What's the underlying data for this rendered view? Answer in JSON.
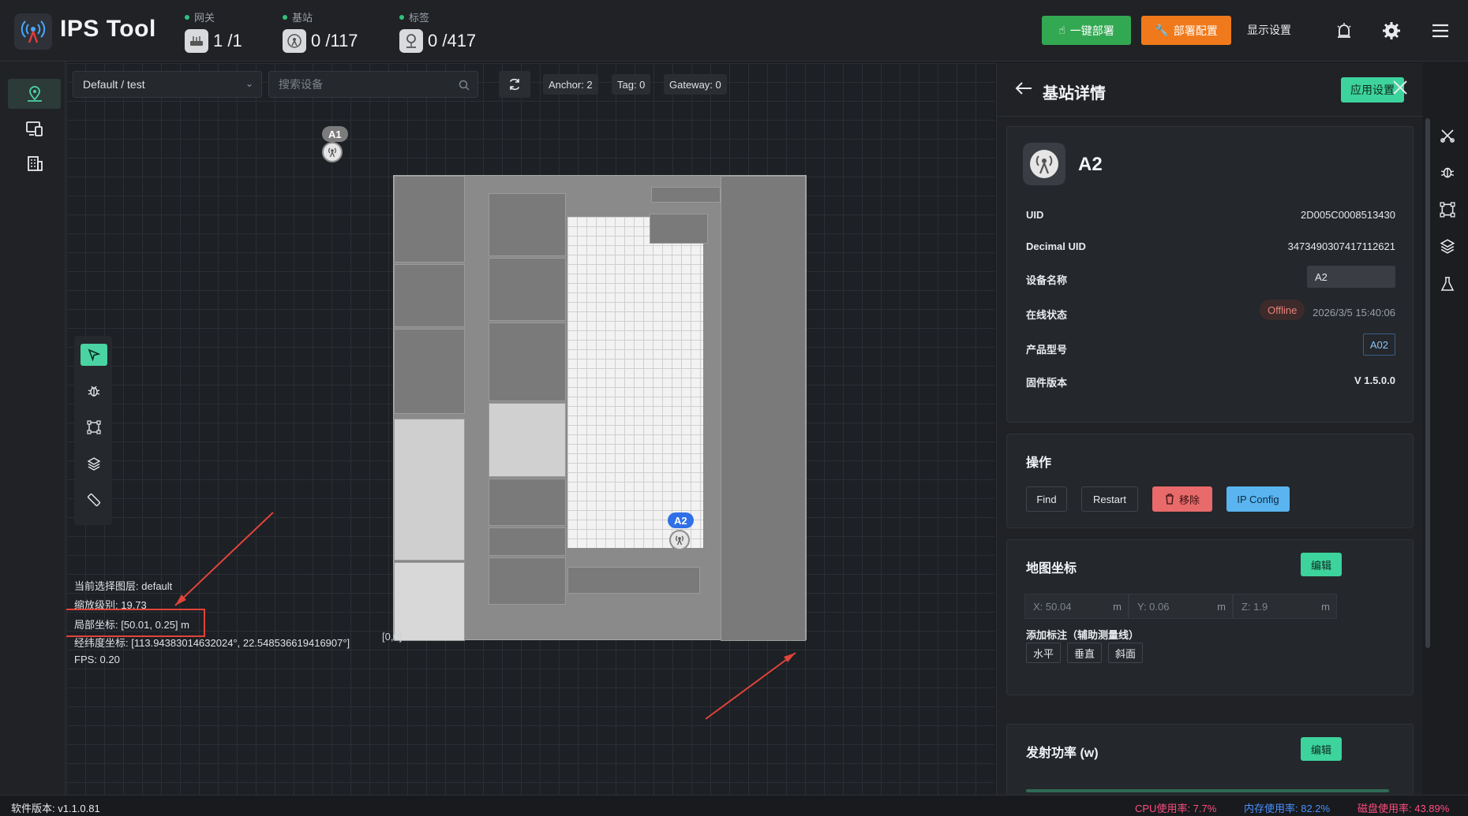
{
  "app": {
    "title": "IPS Tool"
  },
  "stats": [
    {
      "label": "网关",
      "value": "1 /1"
    },
    {
      "label": "基站",
      "value": "0 /117"
    },
    {
      "label": "标签",
      "value": "0 /417"
    }
  ],
  "header_buttons": {
    "deploy": "一键部署",
    "config": "部署配置",
    "display": "显示设置"
  },
  "map_toolbar": {
    "scene": "Default / test",
    "search_placeholder": "搜索设备",
    "anchor_chip": "Anchor: 2",
    "tag_chip": "Tag: 0",
    "gateway_chip": "Gateway: 0"
  },
  "map": {
    "anchors": [
      {
        "label": "A1",
        "color": "#7c7c7c"
      },
      {
        "label": "A2",
        "color": "#2f6fe8"
      }
    ],
    "origin_label": "[0,0]"
  },
  "map_info": {
    "layer_label": "当前选择图层:",
    "layer_value": "default",
    "zoom_label": "缩放级别:",
    "zoom_value": "19.73",
    "local_label": "局部坐标:",
    "local_value": "[50.01, 0.25] m",
    "geo_label": "经纬度坐标:",
    "geo_value": "[113.94383014632024°, 22.548536619416907°]",
    "fps_label": "FPS:",
    "fps_value": "0.20"
  },
  "panel": {
    "title": "基站详情",
    "apply_button": "应用设置",
    "device_name": "A2",
    "fields": [
      {
        "key": "UID",
        "value": "2D005C0008513430"
      },
      {
        "key": "Decimal UID",
        "value": "3473490307417112621"
      },
      {
        "key": "设备名称",
        "value": "A2"
      },
      {
        "key": "在线状态",
        "value": "2026/3/5 15:40:06",
        "badge": "Offline"
      },
      {
        "key": "产品型号",
        "value": "A02"
      },
      {
        "key": "固件版本",
        "value": "V 1.5.0.0"
      }
    ],
    "ops_title": "操作",
    "ops": {
      "find": "Find",
      "restart": "Restart",
      "remove": "移除",
      "ipconfig": "IP Config"
    },
    "coord_title": "地图坐标",
    "edit_label": "编辑",
    "coords": [
      {
        "text": "X: 50.04",
        "unit": "m"
      },
      {
        "text": "Y: 0.06",
        "unit": "m"
      },
      {
        "text": "Z: 1.9",
        "unit": "m"
      }
    ],
    "annotate_label": "添加标注（辅助测量线）",
    "annotate_buttons": [
      "水平",
      "垂直",
      "斜面"
    ],
    "power_title": "发射功率 (w)"
  },
  "status_bar": {
    "version": "软件版本: v1.1.0.81",
    "cpu": "CPU使用率: 7.7%",
    "mem": "内存使用率: 82.2%",
    "disk": "磁盘使用率: 43.89%"
  },
  "colors": {
    "accent": "#3dd39d",
    "deploy_green": "#33a852",
    "config_orange": "#f07a1b",
    "remove_red": "#e86a6a",
    "ipconfig_blue": "#5ab4f0",
    "offline_badge": "#e8827a"
  }
}
